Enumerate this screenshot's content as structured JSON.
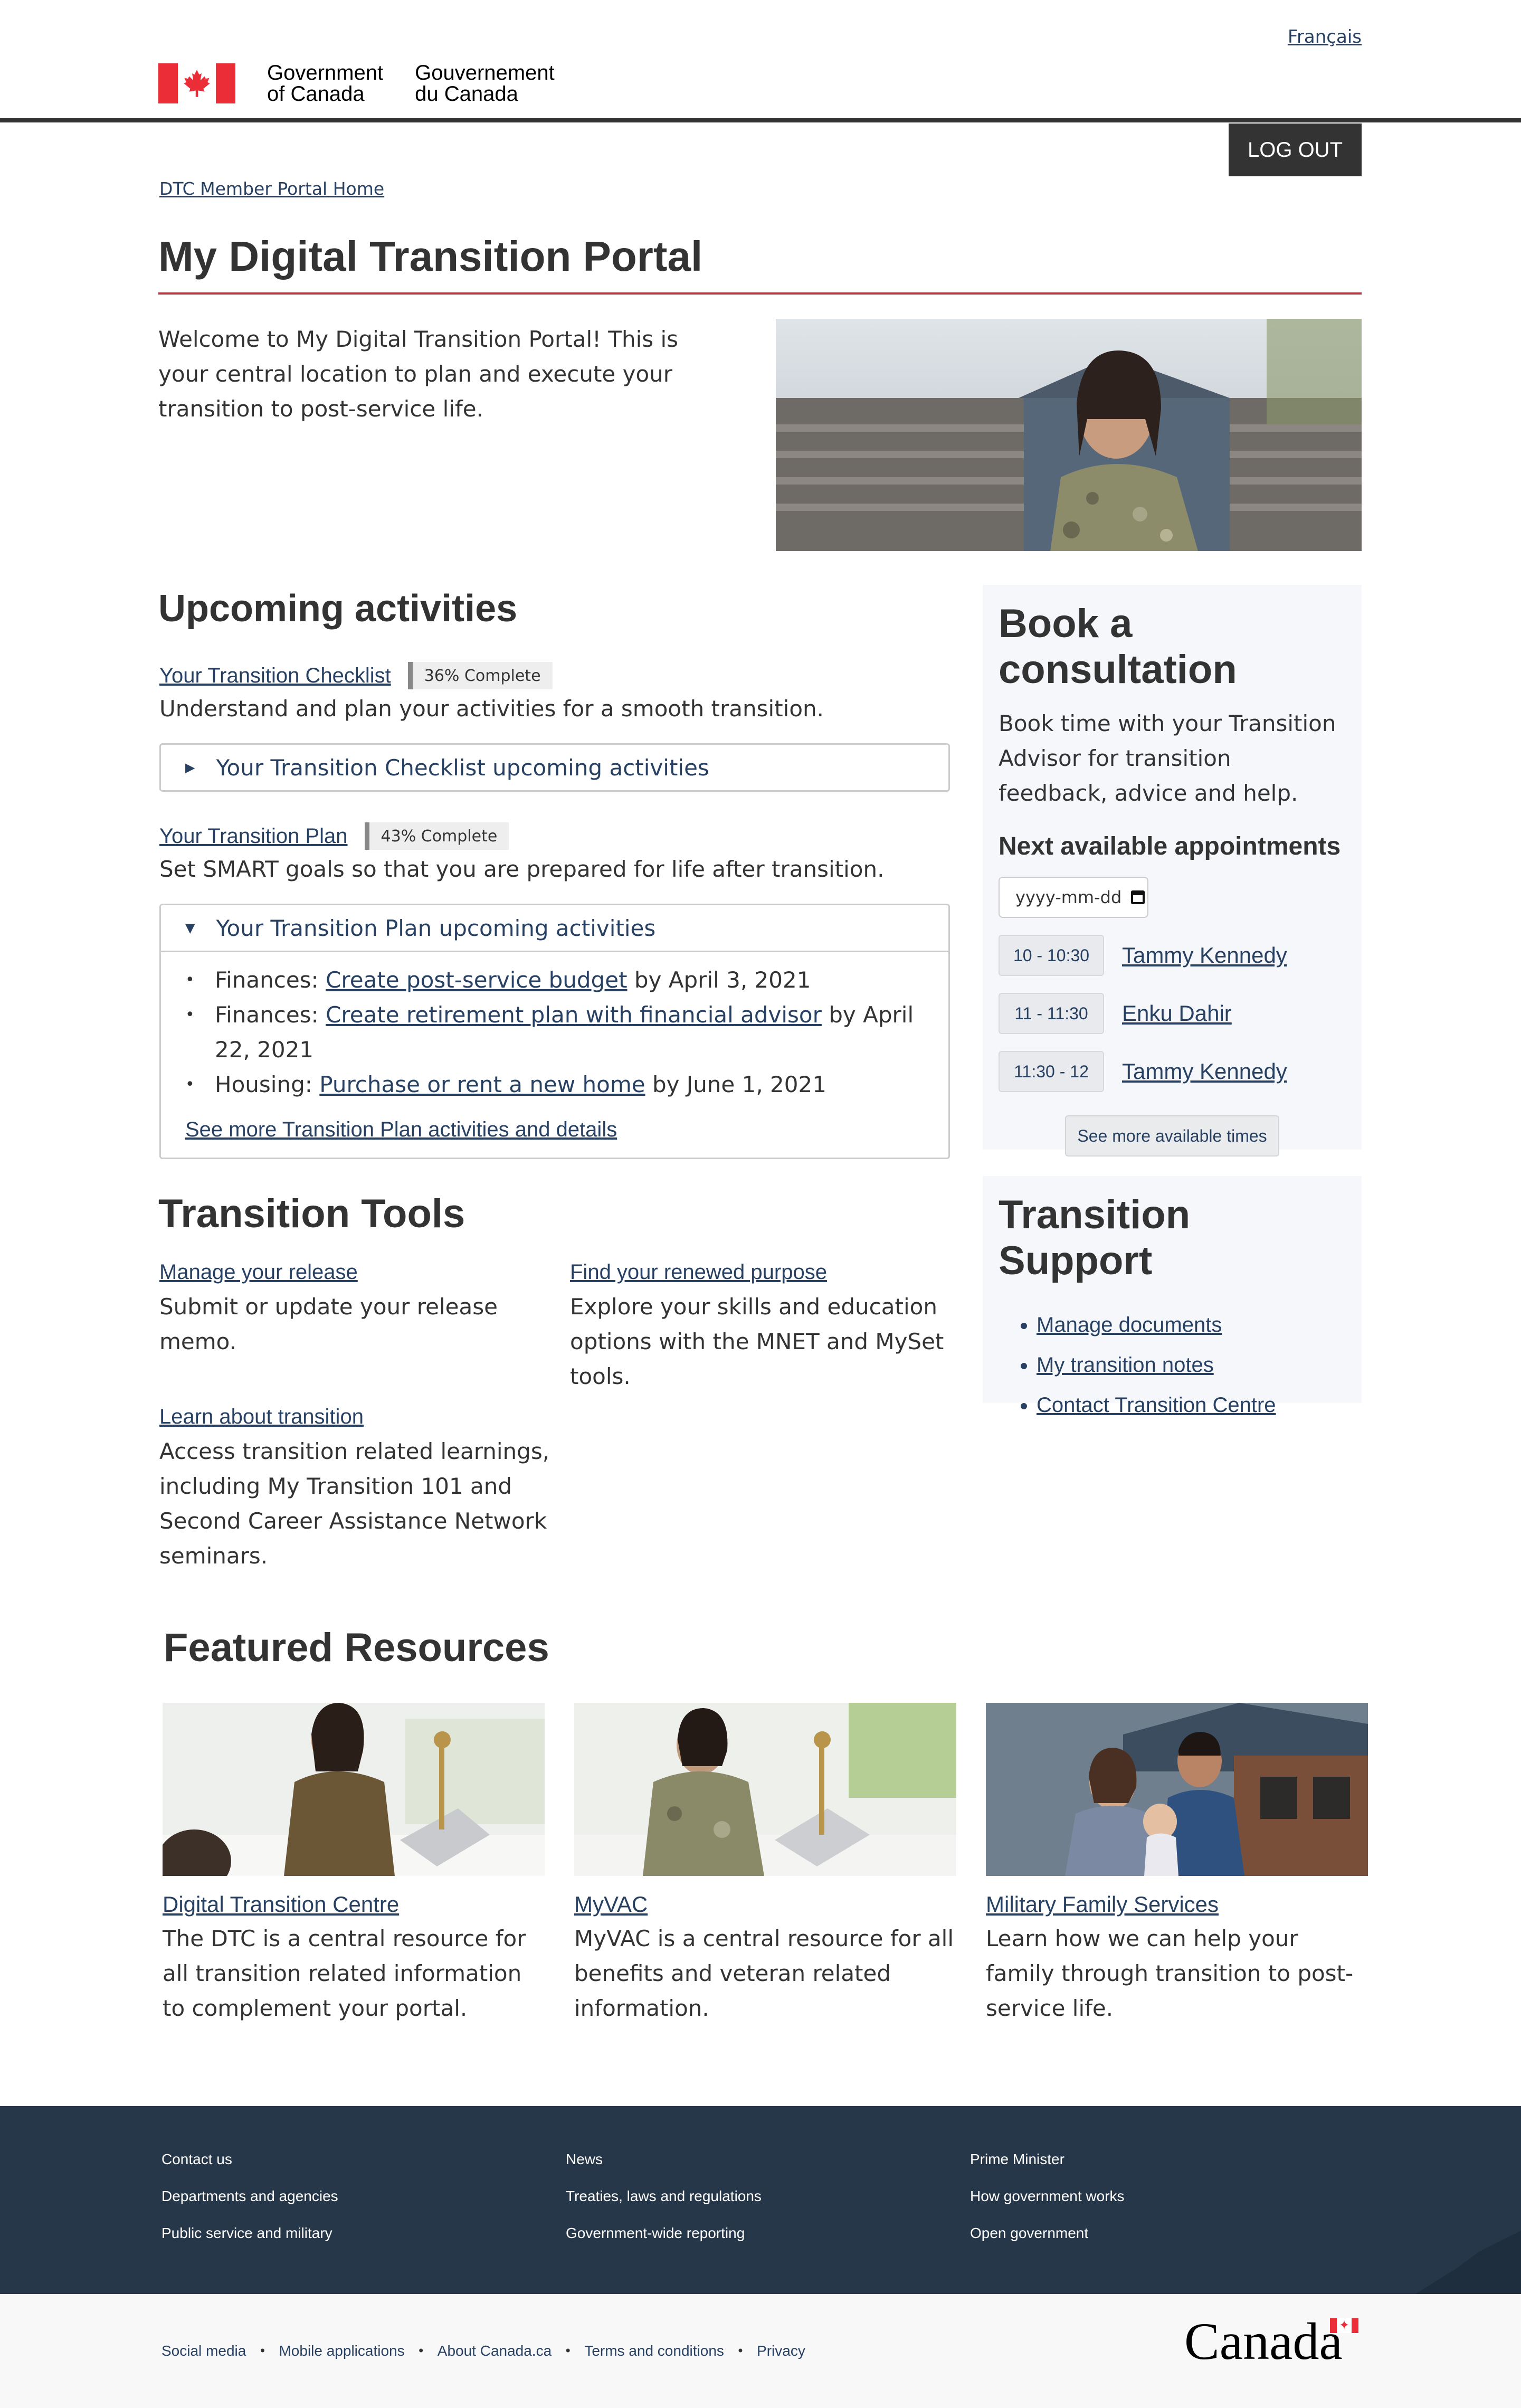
{
  "header": {
    "language_link": "Français",
    "gov_en_line1": "Government",
    "gov_en_line2": "of Canada",
    "gov_fr_line1": "Gouvernement",
    "gov_fr_line2": "du Canada",
    "logout_label": "LOG OUT"
  },
  "breadcrumb": {
    "home": "DTC Member Portal Home"
  },
  "page_title": "My Digital Transition Portal",
  "intro": "Welcome to My Digital Transition Portal! This is your central location to plan and execute your transition to post-service life.",
  "upcoming": {
    "heading": "Upcoming activities",
    "checklist": {
      "link": "Your Transition Checklist",
      "progress_label": "36% Complete",
      "description": "Understand and plan your activities for a smooth transition.",
      "toggle": "Your Transition Checklist upcoming activities"
    },
    "plan": {
      "link": "Your Transition Plan",
      "progress_label": "43% Complete",
      "description": "Set SMART goals so that you are prepared for life after transition.",
      "toggle": "Your Transition Plan upcoming activities",
      "items": [
        {
          "category": "Finances:",
          "link": "Create post-service budget",
          "due": "by April 3, 2021"
        },
        {
          "category": "Finances:",
          "link": "Create retirement plan with financial advisor",
          "due": "by April 22, 2021"
        },
        {
          "category": "Housing:",
          "link": "Purchase or rent a new home",
          "due": "by June 1, 2021"
        }
      ],
      "more_link": "See more Transition Plan activities and details"
    }
  },
  "consultation": {
    "heading": "Book a consultation",
    "description": "Book time with your Transition Advisor for transition feedback, advice and help.",
    "subheading": "Next available appointments",
    "date_placeholder": "yyyy-mm-dd",
    "slots": [
      {
        "time": "10 - 10:30",
        "advisor": "Tammy Kennedy"
      },
      {
        "time": "11 - 11:30",
        "advisor": "Enku Dahir"
      },
      {
        "time": "11:30 - 12",
        "advisor": "Tammy Kennedy"
      }
    ],
    "more_button": "See more available times"
  },
  "tools": {
    "heading": "Transition Tools",
    "items": [
      {
        "link": "Manage your release",
        "description": "Submit or update your release memo."
      },
      {
        "link": "Find your renewed purpose",
        "description": "Explore your skills and education options with the MNET and MySet tools."
      },
      {
        "link": "Learn about transition",
        "description": "Access transition related learnings, including My Transition 101 and Second Career Assistance Network seminars."
      }
    ]
  },
  "support": {
    "heading": "Transition Support",
    "links": [
      "Manage documents",
      "My transition notes",
      "Contact Transition Centre"
    ]
  },
  "featured": {
    "heading": "Featured Resources",
    "cards": [
      {
        "link": "Digital Transition Centre",
        "description": "The DTC is a central resource for all transition related information to complement your portal."
      },
      {
        "link": "MyVAC",
        "description": "MyVAC is a central resource for all benefits and veteran related information."
      },
      {
        "link": "Military Family Services",
        "description": "Learn how we can help your family through transition to post-service life."
      }
    ]
  },
  "footer": {
    "col1": [
      "Contact us",
      "Departments and agencies",
      "Public service and military"
    ],
    "col2": [
      "News",
      "Treaties, laws and regulations",
      "Government-wide reporting"
    ],
    "col3": [
      "Prime Minister",
      "How government works",
      "Open government"
    ],
    "sub_links": [
      "Social media",
      "Mobile applications",
      "About Canada.ca",
      "Terms and conditions",
      "Privacy"
    ],
    "wordmark": "Canada"
  },
  "colors": {
    "link": "#284162",
    "title_rule": "#af3c43",
    "footer_bg": "#26374a",
    "flag_red": "#eb2d37",
    "panel_bg": "#f5f7fa"
  }
}
